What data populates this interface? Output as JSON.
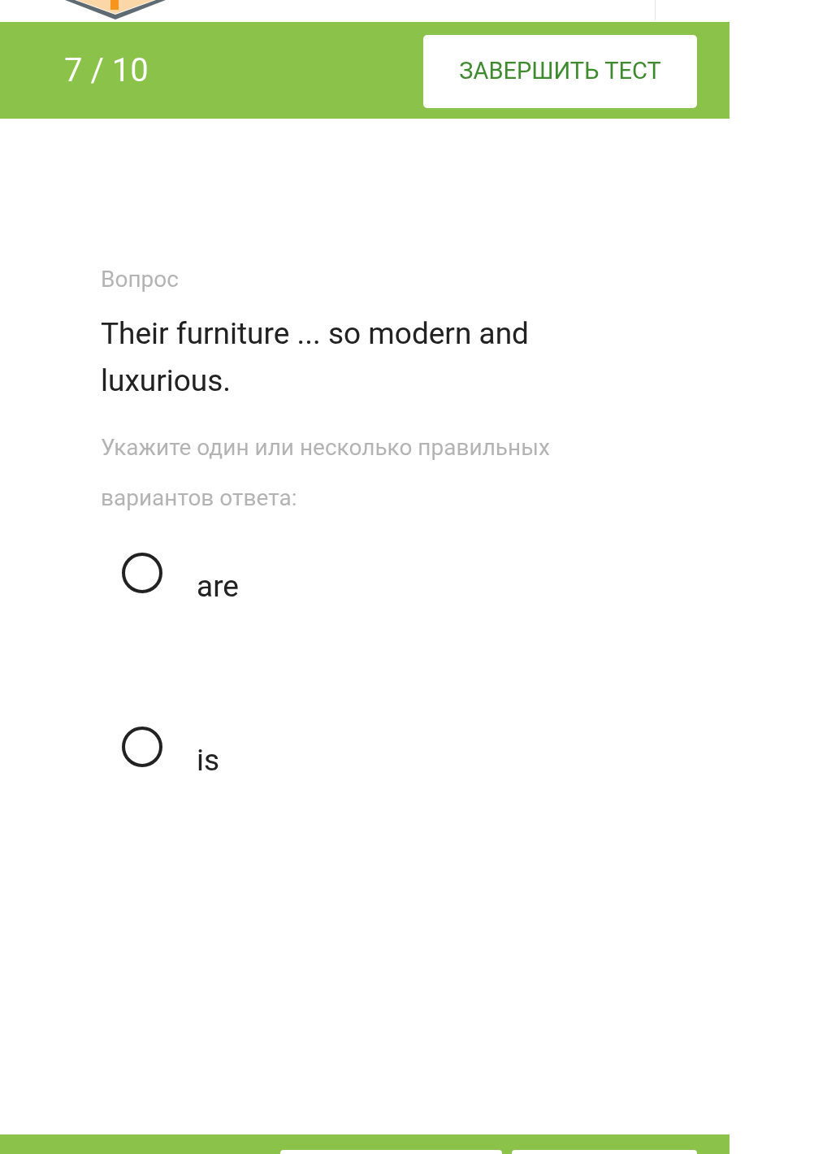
{
  "progress": "7 / 10",
  "finish_button": "ЗАВЕРШИТЬ ТЕСТ",
  "question": {
    "label": "Вопрос",
    "text": "Their furniture ... so modern and luxurious.",
    "instruction": "Укажите один или несколько правильных вариантов ответа:"
  },
  "options": [
    {
      "label": "are",
      "selected": false
    },
    {
      "label": "is",
      "selected": false
    }
  ]
}
